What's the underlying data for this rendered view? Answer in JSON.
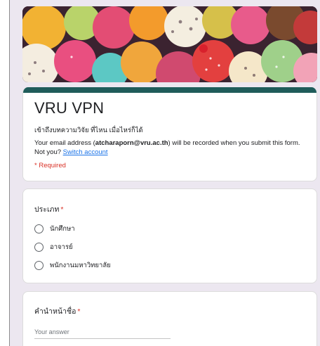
{
  "form": {
    "title": "VRU VPN",
    "description": "เข้าถึงบทความวิจัย ที่ไหน เมื่อไหร่ก็ได้",
    "email_prefix": "Your email address (",
    "email": "atcharaporn@vru.ac.th",
    "email_suffix": ") will be recorded when you submit this form.",
    "not_you": "Not you?",
    "switch_account": "Switch account",
    "required_note": "* Required"
  },
  "questions": [
    {
      "title": "ประเภท",
      "required_mark": "*",
      "options": [
        "นักศึกษา",
        "อาจารย์",
        "พนักงานมหาวิทยาลัย"
      ]
    },
    {
      "title": "คำนำหน้าชื่อ",
      "required_mark": "*",
      "placeholder": "Your answer"
    }
  ],
  "colors": {
    "theme_bar": "#1f5c5a",
    "background": "#ece7f0",
    "required": "#d93025",
    "link": "#1a73e8"
  },
  "icons": {
    "banner": "ice-cream-illustration"
  }
}
